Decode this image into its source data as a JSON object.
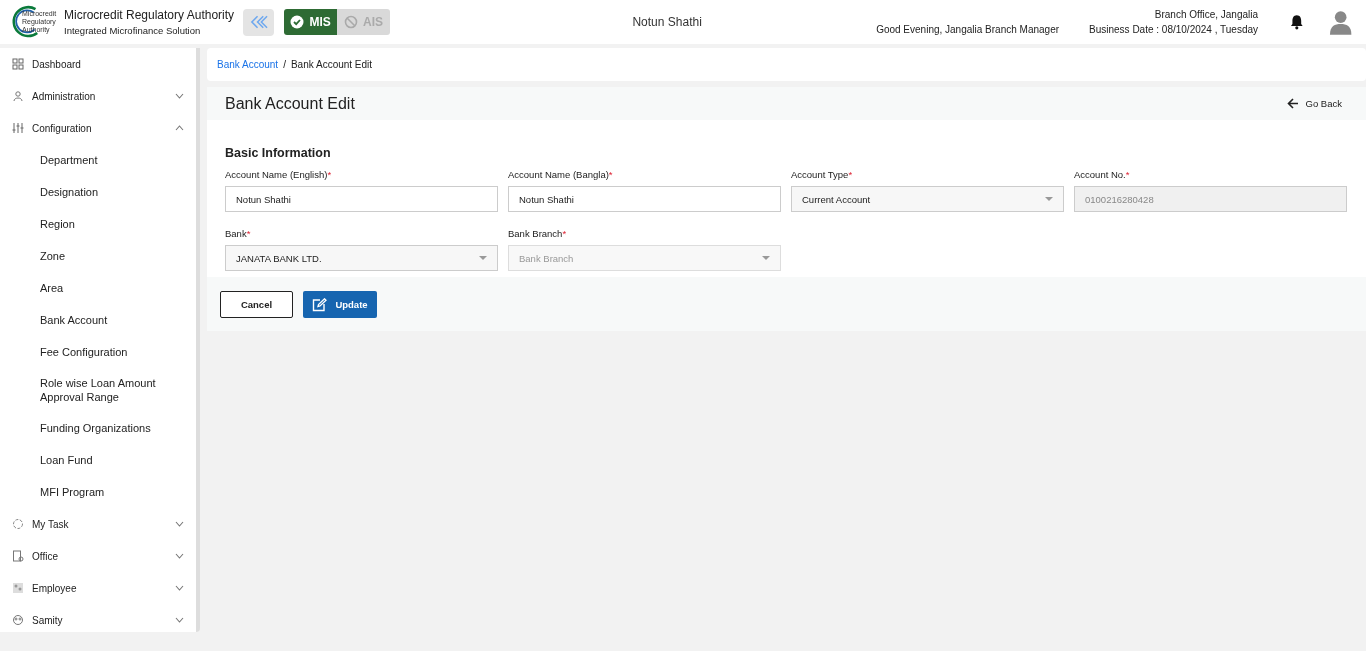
{
  "header": {
    "logo_text": "Microcredit Regulatory Authority",
    "org_name": "Microcredit Regulatory Authority",
    "org_subtitle": "Integrated Microfinance Solution",
    "modules": [
      {
        "label": "MIS",
        "selected": true
      },
      {
        "label": "AIS",
        "selected": false
      }
    ],
    "center_title": "Notun Shathi",
    "greeting": "Good Evening, Jangalia Branch Manager",
    "office": "Branch Office, Jangalia",
    "business_date": "Business Date : 08/10/2024 , Tuesday"
  },
  "sidebar": {
    "items": [
      {
        "label": "Dashboard",
        "expandable": false
      },
      {
        "label": "Administration",
        "expandable": true,
        "expanded": false
      },
      {
        "label": "Configuration",
        "expandable": true,
        "expanded": true,
        "children": [
          {
            "label": "Department"
          },
          {
            "label": "Designation"
          },
          {
            "label": "Region"
          },
          {
            "label": "Zone"
          },
          {
            "label": "Area"
          },
          {
            "label": "Bank Account"
          },
          {
            "label": "Fee Configuration"
          },
          {
            "label": "Role wise Loan Amount Approval Range"
          },
          {
            "label": "Funding Organizations"
          },
          {
            "label": "Loan Fund"
          },
          {
            "label": "MFI Program"
          }
        ]
      },
      {
        "label": "My Task",
        "expandable": true,
        "expanded": false
      },
      {
        "label": "Office",
        "expandable": true,
        "expanded": false
      },
      {
        "label": "Employee",
        "expandable": true,
        "expanded": false
      },
      {
        "label": "Samity",
        "expandable": true,
        "expanded": false
      }
    ]
  },
  "breadcrumb": {
    "separator": "/",
    "items": [
      {
        "label": "Bank Account",
        "kind": "link"
      },
      {
        "label": "Bank Account Edit",
        "kind": "current"
      }
    ]
  },
  "page": {
    "title": "Bank Account Edit",
    "back": "Go Back",
    "section": "Basic Information",
    "fields": [
      {
        "label": "Account Name (English)",
        "required_mark": "*",
        "kind": "text",
        "value": "Notun Shathi",
        "disabled": false
      },
      {
        "label": "Account Name (Bangla)",
        "required_mark": "*",
        "kind": "text",
        "value": "Notun Shathi",
        "disabled": false
      },
      {
        "label": "Account Type",
        "required_mark": "*",
        "kind": "select",
        "value": "Current Account",
        "disabled": false
      },
      {
        "label": "Account No.",
        "required_mark": "*",
        "kind": "text",
        "value": "0100216280428",
        "disabled": true
      },
      {
        "label": "Bank",
        "required_mark": "*",
        "kind": "select",
        "value": "JANATA BANK LTD.",
        "disabled": false
      },
      {
        "label": "Bank Branch",
        "required_mark": "*",
        "kind": "select",
        "placeholder": "Bank Branch",
        "disabled": true
      }
    ],
    "buttons": [
      {
        "label": "Cancel",
        "kind": "outline"
      },
      {
        "label": "Update",
        "kind": "primary"
      }
    ]
  }
}
